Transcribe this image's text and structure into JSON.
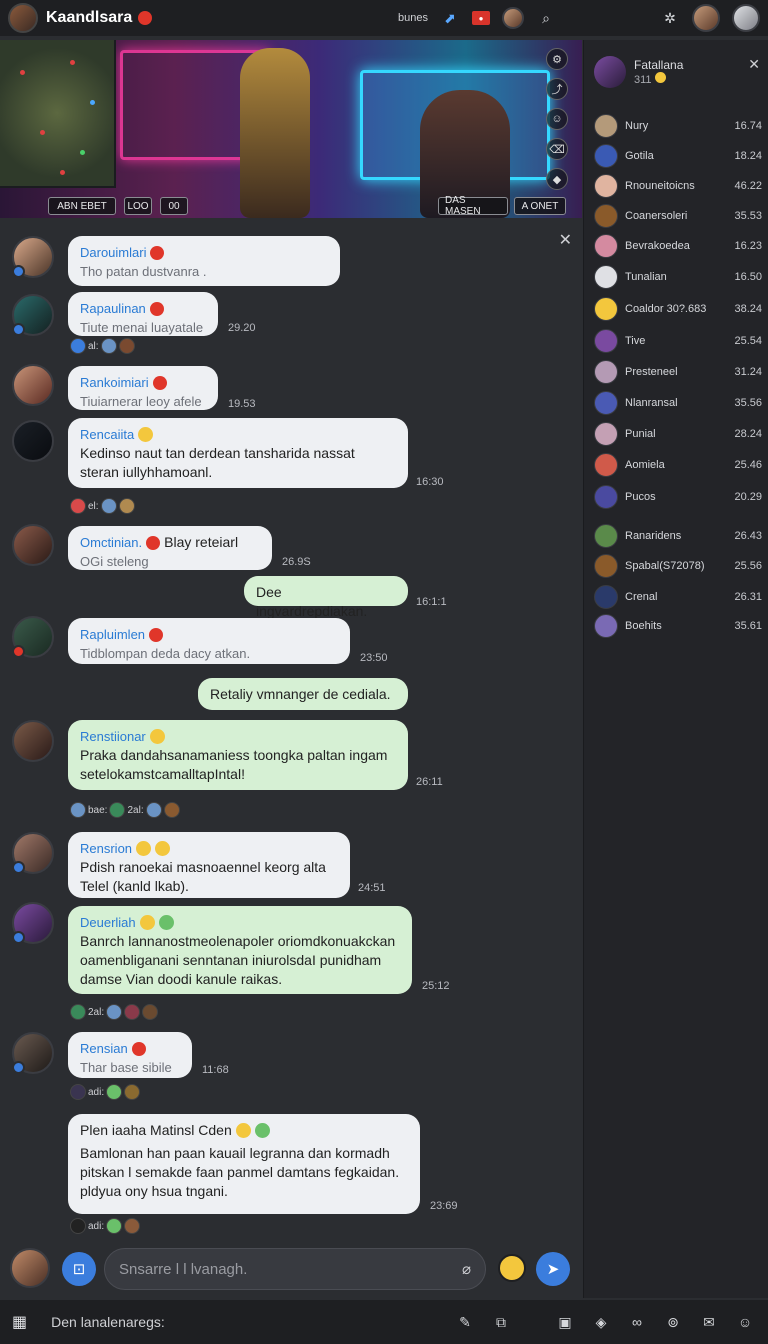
{
  "header": {
    "title": "Kaandlsara",
    "label": "bunes"
  },
  "banner": {
    "button_left": "ABN EBET",
    "button_mid1": "LOO",
    "button_mid2": "00",
    "button_right1": "DAS MASEN",
    "button_right2": "A ONET"
  },
  "messages": [
    {
      "name": "Darouimlari",
      "text": "Tho patan dustvanra .",
      "time": ""
    },
    {
      "name": "Rapaulinan",
      "text": "Tiute menai luayatale",
      "time": "29.20"
    },
    {
      "name": "Rankoimiari",
      "text": "Tiuiarnerar leoy afele",
      "time": "19.53"
    },
    {
      "name": "Rencaiita",
      "text": "Kedinso naut tan derdean tansharida nassat",
      "text2": "steran iullyhhamoanl.",
      "time": "16:30"
    },
    {
      "name": "Omctinian.",
      "extra": "Blay reteiarl",
      "text": "OGi steleng",
      "time": "26.9S"
    },
    {
      "text": "Dee ingvardrepdiakan.",
      "time": "16:1:1"
    },
    {
      "name": "Rapluimlen",
      "text": "Tidblompan deda dacy atkan.",
      "time": "23:50"
    },
    {
      "text": "Retaliy vmnanger de cediala."
    },
    {
      "name": "Renstiionar",
      "text": "Praka dandahsanamaniess toongka paltan ingam",
      "text2": "setelokamstcamalltapIntal!",
      "time": "26:11"
    },
    {
      "name": "Rensrion",
      "text": "Pdish  ranoekai masnoaennel keorg alta",
      "text2": "Telel (kanld lkab).",
      "time": "24:51"
    },
    {
      "name": "Deuerliah",
      "text": "Banrch lannanostmeolenapoler oriomdkonuakckan",
      "text2": "oamenbliganani senntanan iniurolsdaI punidham",
      "text3": "damse Vian doodi kanule raikas.",
      "time": "25:12"
    },
    {
      "name": "Rensian",
      "text": "Thar base sibile",
      "time": "11:68"
    },
    {
      "name": "Plen iaaha Matinsl Cden",
      "text": "Bamlonan han paan kauail legranna dan kormadh",
      "text2": "pitskan l semakde faan panmel damtans fegkaidan.",
      "text3": "pldyua ony hsua tngani.",
      "time": "23:69"
    }
  ],
  "reactions": {
    "r1": "al:",
    "r2": "el:",
    "r3": "bae:",
    "r3b": "2al:",
    "r4": "2al:",
    "r5": "adi:",
    "r6": "adi:"
  },
  "right_panel": {
    "title": "Fatallana",
    "subtitle": "311",
    "members": [
      {
        "name": "Nury",
        "value": "16.74"
      },
      {
        "name": "Gotila",
        "value": "18.24"
      },
      {
        "name": "Rnouneitoicns",
        "value": "46.22"
      },
      {
        "name": "Coanersoleri",
        "value": "35.53"
      },
      {
        "name": "Bevrakoedea",
        "value": "16.23"
      },
      {
        "name": "Tunalian",
        "value": "16.50"
      },
      {
        "name": "Coaldor 30?.683",
        "value": "38.24"
      },
      {
        "name": "Tive",
        "value": "25.54"
      },
      {
        "name": "Presteneel",
        "value": "31.24"
      },
      {
        "name": "Nlanransal",
        "value": "35.56"
      },
      {
        "name": "Punial",
        "value": "28.24"
      },
      {
        "name": "Aomiela",
        "value": "25.46"
      },
      {
        "name": "Pucos",
        "value": "20.29"
      },
      {
        "name": "Ranaridens",
        "value": "26.43"
      },
      {
        "name": "Spabal(S72078)",
        "value": "25.56"
      },
      {
        "name": "Crenal",
        "value": "26.31"
      },
      {
        "name": "Boehits",
        "value": "35.61"
      }
    ]
  },
  "composer": {
    "placeholder": "Snsarre l l lvanagh."
  },
  "bottombar": {
    "text": "Den lanalenaregs:"
  }
}
